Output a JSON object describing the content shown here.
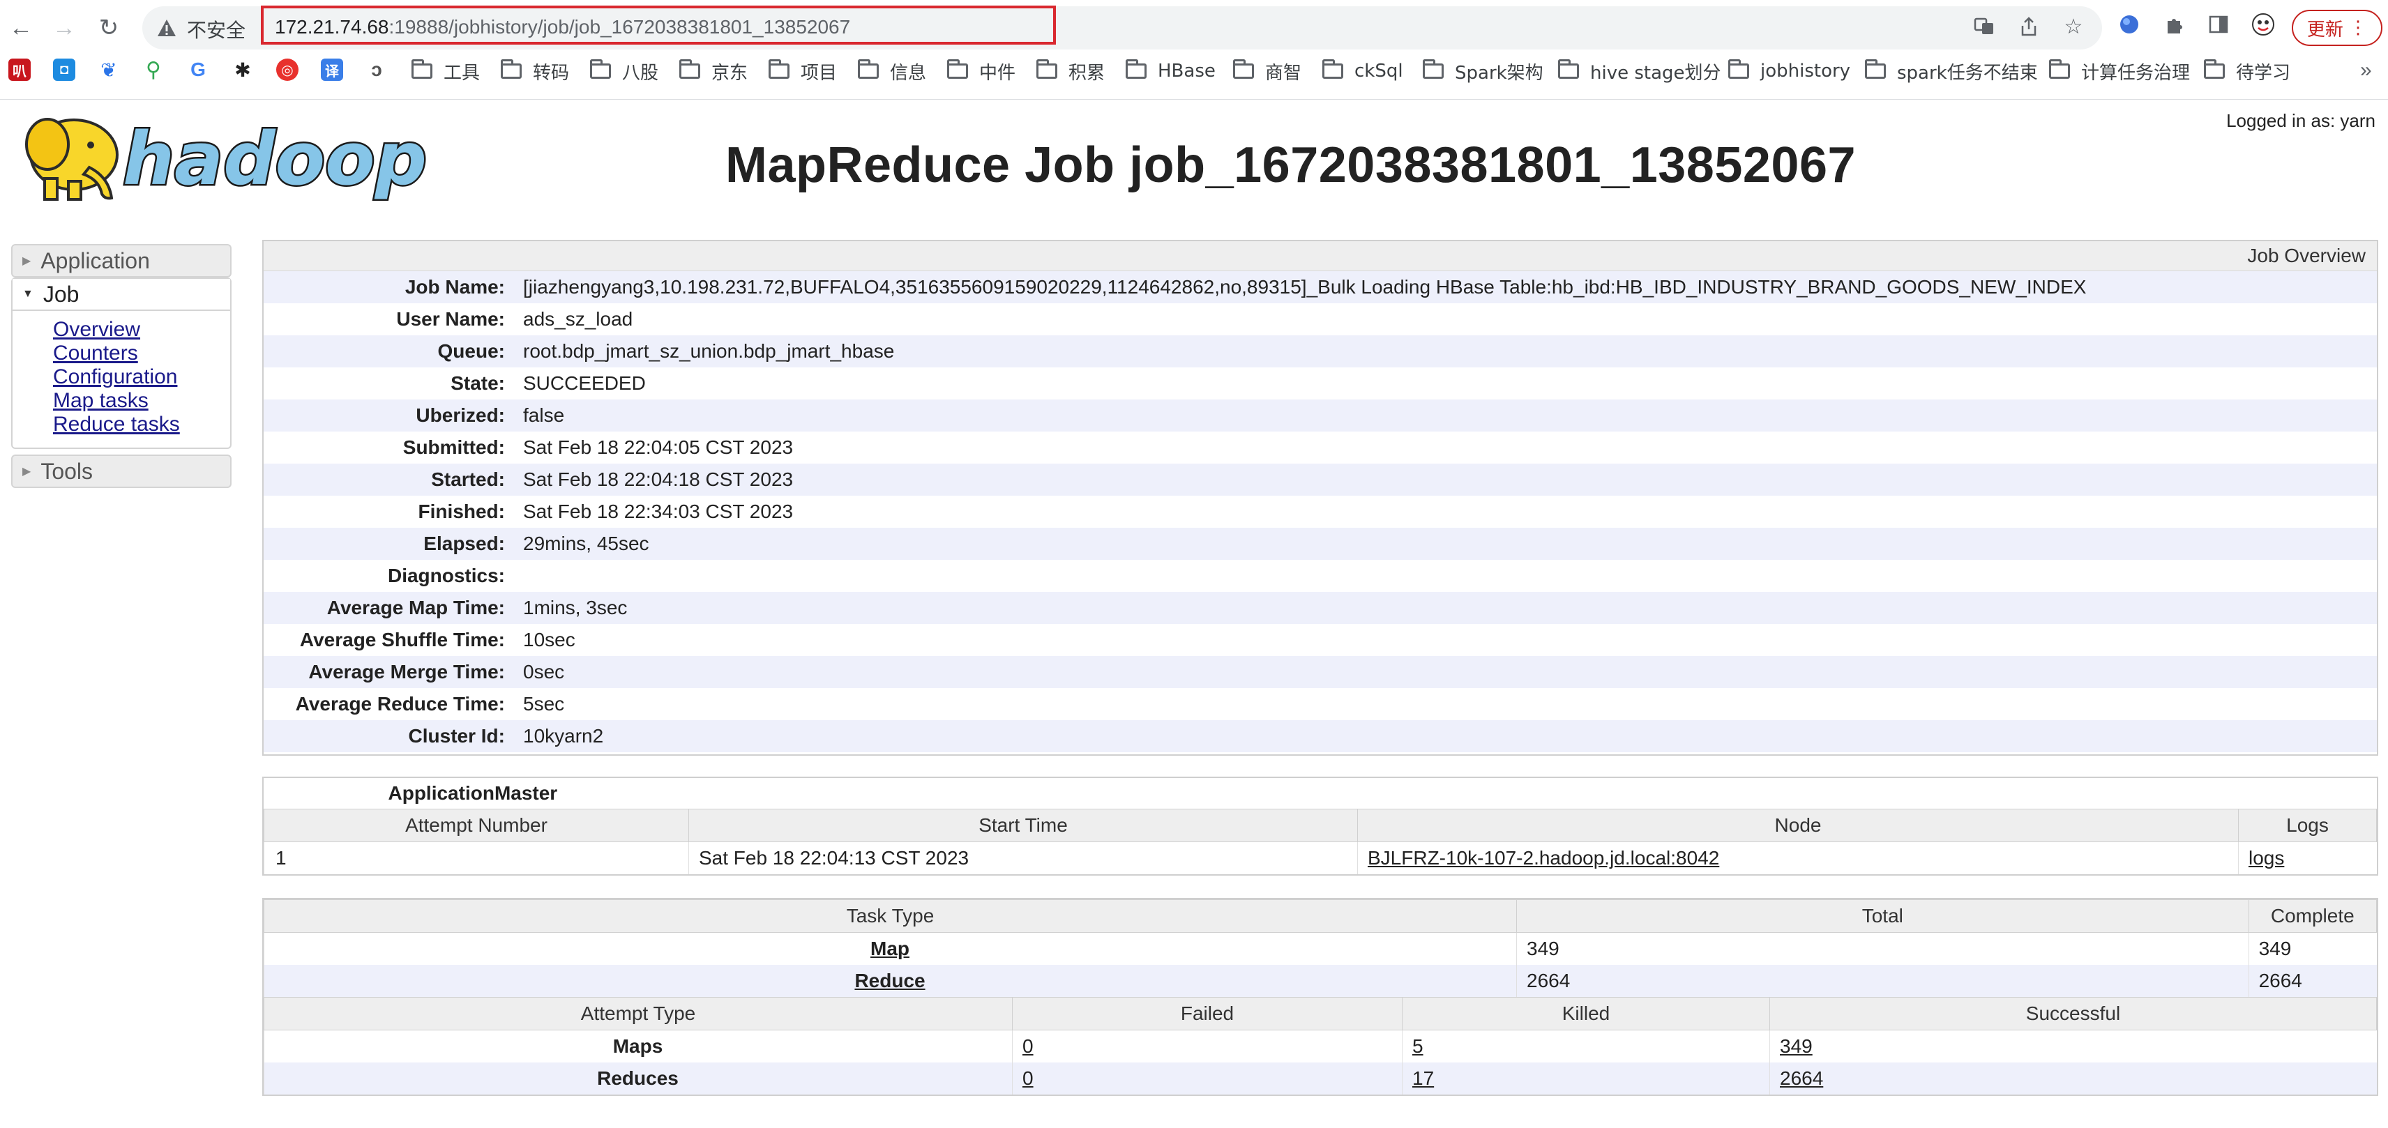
{
  "browser": {
    "insecure_label": "不安全",
    "url_host": "172.21.74.68",
    "url_rest": ":19888/jobhistory/job/job_1672038381801_13852067",
    "update_label": "更新",
    "bookmark_folders": [
      "工具",
      "转码",
      "八股",
      "京东",
      "项目",
      "信息",
      "中件",
      "积累",
      "HBase",
      "商智",
      "ckSql",
      "Spark架构",
      "hive stage划分",
      "jobhistory",
      "spark任务不结束",
      "计算任务治理",
      "待学习"
    ],
    "more_label": "»"
  },
  "header": {
    "logo_text": "hadoop",
    "title": "MapReduce Job job_1672038381801_13852067",
    "logged_in": "Logged in as: yarn"
  },
  "nav": {
    "application": "Application",
    "job": "Job",
    "job_links": [
      "Overview",
      "Counters",
      "Configuration",
      "Map tasks",
      "Reduce tasks"
    ],
    "tools": "Tools"
  },
  "overview": {
    "heading": "Job Overview",
    "rows": [
      {
        "label": "Job Name:",
        "value": "[jiazhengyang3,10.198.231.72,BUFFALO4,3516355609159020229,1124642862,no,89315]_Bulk Loading HBase Table:hb_ibd:HB_IBD_INDUSTRY_BRAND_GOODS_NEW_INDEX"
      },
      {
        "label": "User Name:",
        "value": "ads_sz_load"
      },
      {
        "label": "Queue:",
        "value": "root.bdp_jmart_sz_union.bdp_jmart_hbase"
      },
      {
        "label": "State:",
        "value": "SUCCEEDED"
      },
      {
        "label": "Uberized:",
        "value": "false"
      },
      {
        "label": "Submitted:",
        "value": "Sat Feb 18 22:04:05 CST 2023"
      },
      {
        "label": "Started:",
        "value": "Sat Feb 18 22:04:18 CST 2023"
      },
      {
        "label": "Finished:",
        "value": "Sat Feb 18 22:34:03 CST 2023"
      },
      {
        "label": "Elapsed:",
        "value": "29mins, 45sec"
      },
      {
        "label": "Diagnostics:",
        "value": ""
      },
      {
        "label": "Average Map Time:",
        "value": "1mins, 3sec"
      },
      {
        "label": "Average Shuffle Time:",
        "value": "10sec"
      },
      {
        "label": "Average Merge Time:",
        "value": "0sec"
      },
      {
        "label": "Average Reduce Time:",
        "value": "5sec"
      },
      {
        "label": "Cluster Id:",
        "value": "10kyarn2"
      }
    ]
  },
  "am": {
    "caption": "ApplicationMaster",
    "headers": [
      "Attempt Number",
      "Start Time",
      "Node",
      "Logs"
    ],
    "row": {
      "attempt": "1",
      "start": "Sat Feb 18 22:04:13 CST 2023",
      "node": "BJLFRZ-10k-107-2.hadoop.jd.local:8042",
      "logs": "logs"
    }
  },
  "tasks": {
    "headers": [
      "Task Type",
      "Total",
      "Complete"
    ],
    "rows": [
      {
        "type": "Map",
        "total": "349",
        "complete": "349"
      },
      {
        "type": "Reduce",
        "total": "2664",
        "complete": "2664"
      }
    ],
    "attempt_headers": [
      "Attempt Type",
      "Failed",
      "Killed",
      "Successful"
    ],
    "attempt_rows": [
      {
        "type": "Maps",
        "failed": "0",
        "killed": "5",
        "successful": "349"
      },
      {
        "type": "Reduces",
        "failed": "0",
        "killed": "17",
        "successful": "2664"
      }
    ]
  }
}
